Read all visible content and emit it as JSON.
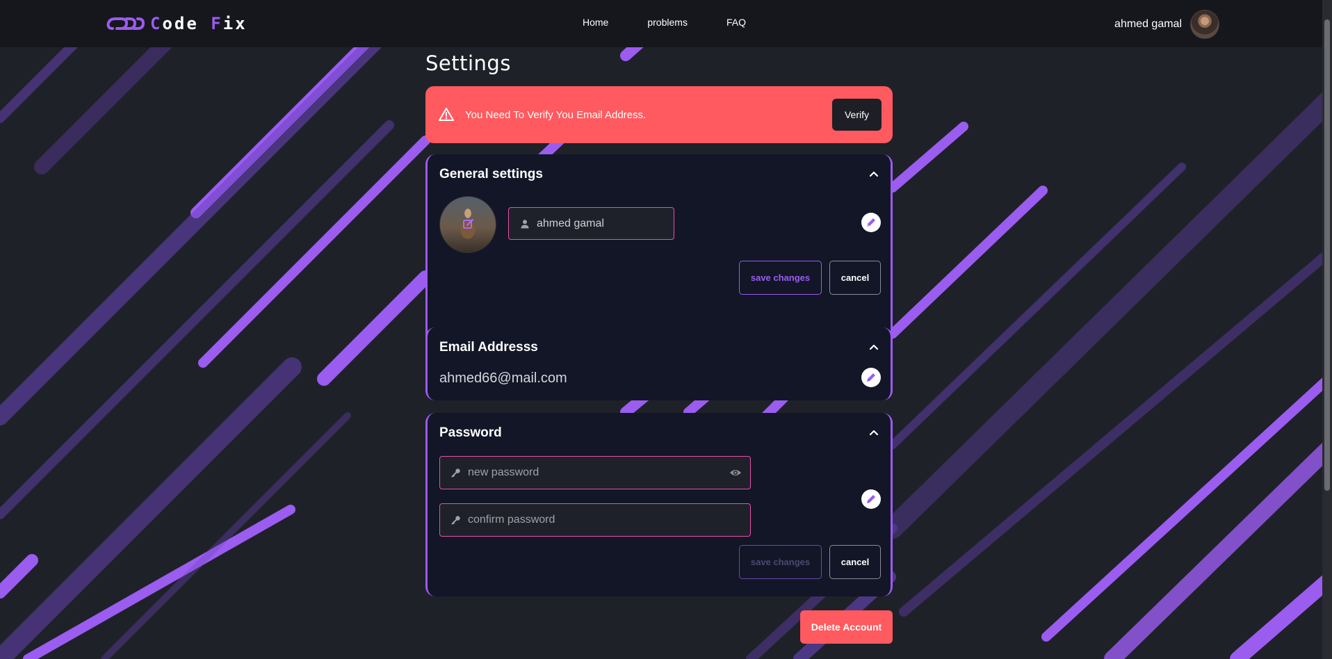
{
  "brand": {
    "logo_icon": "infinity-chain-icon",
    "name_first": "C",
    "name_middle": "ode ",
    "name_f": "F",
    "name_rest": "ix",
    "accent_color": "#9b5cf0"
  },
  "nav": {
    "links": [
      "Home",
      "problems",
      "FAQ"
    ],
    "user_name": "ahmed gamal"
  },
  "page": {
    "title": "Settings"
  },
  "alert": {
    "icon": "warning-triangle-icon",
    "message": "You Need To Verify You Email Address.",
    "button_label": "Verify",
    "color": "#ff5a5f"
  },
  "general": {
    "title": "General settings",
    "name_value": "ahmed gamal",
    "name_icon": "user-icon",
    "save_label": "save changes",
    "cancel_label": "cancel"
  },
  "email": {
    "title": "Email Addresss",
    "value": "ahmed66@mail.com"
  },
  "password": {
    "title": "Password",
    "new_placeholder": "new password",
    "confirm_placeholder": "confirm password",
    "key_icon": "key-icon",
    "eye_icon": "eye-icon",
    "save_label": "save changes",
    "cancel_label": "cancel"
  },
  "account": {
    "delete_label": "Delete Account",
    "delete_color": "#ff5a5f"
  }
}
